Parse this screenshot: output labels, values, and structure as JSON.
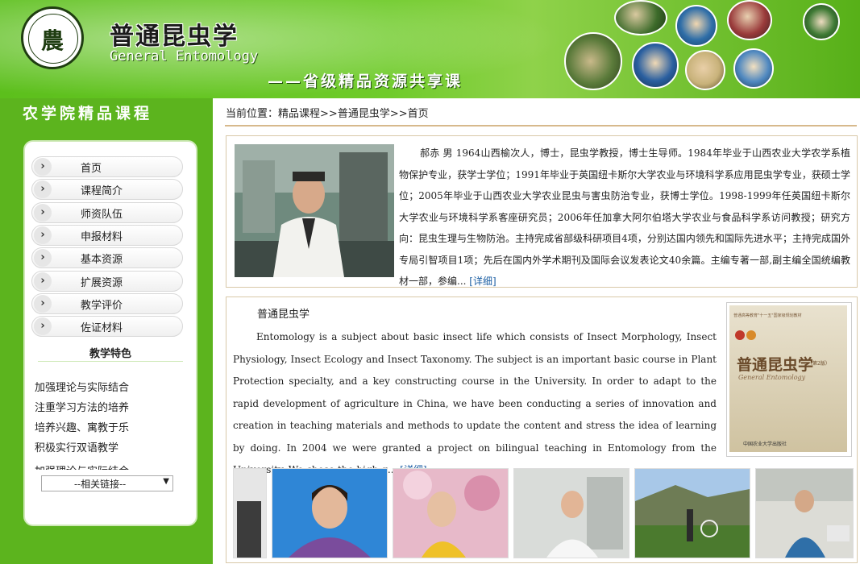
{
  "header": {
    "title_cn": "普通昆虫学",
    "title_en": "General Entomology",
    "subtitle": "——省级精品资源共享课",
    "logo_glyph": "農"
  },
  "sidebar": {
    "title": "农学院精品课程",
    "nav": [
      {
        "label": "首页",
        "icon": "chevron-right-icon"
      },
      {
        "label": "课程简介",
        "icon": "chevron-right-icon"
      },
      {
        "label": "师资队伍",
        "icon": "chevron-right-icon"
      },
      {
        "label": "申报材料",
        "icon": "chevron-right-icon"
      },
      {
        "label": "基本资源",
        "icon": "chevron-right-icon"
      },
      {
        "label": "扩展资源",
        "icon": "chevron-right-icon"
      },
      {
        "label": "教学评价",
        "icon": "chevron-right-icon"
      },
      {
        "label": "佐证材料",
        "icon": "chevron-right-icon"
      }
    ],
    "features_title": "教学特色",
    "features": [
      "加强理论与实际结合",
      "注重学习方法的培养",
      "培养兴趣、寓教于乐",
      "积极实行双语教学",
      "加强理论与实际结合"
    ],
    "links_select": "--相关链接--"
  },
  "breadcrumb": {
    "prefix": "当前位置：",
    "items": [
      "精品课程",
      ">>",
      "普通昆虫学",
      ">>",
      "首页"
    ]
  },
  "teacher": {
    "bio": "郝赤  男  1964山西榆次人，博士，昆虫学教授，博士生导师。1984年毕业于山西农业大学农学系植物保护专业，获学士学位；1991年毕业于英国纽卡斯尔大学农业与环境科学系应用昆虫学专业，获硕士学位；2005年毕业于山西农业大学农业昆虫与害虫防治专业，获博士学位。1998-1999年任英国纽卡斯尔大学农业与环境科学系客座研究员；2006年任加拿大阿尔伯塔大学农业与食品科学系访问教授；研究方向：昆虫生理与生物防治。主持完成省部级科研项目4项，分别达国内领先和国际先进水平；主持完成国外专局引智项目1项；先后在国内外学术期刊及国际会议发表论文40余篇。主编专著一部,副主编全国统编教材一部，参编...",
    "more": "[详细]"
  },
  "course": {
    "heading": "普通昆虫学",
    "intro": "Entomology is a subject about basic insect life which consists of Insect Morphology, Insect Physiology, Insect Ecology and Insect Taxonomy. The subject is an important basic course in Plant Protection specialty, and a key constructing course in the University. In order to adapt to the rapid development of agriculture in China, we have been conducting a series of innovation and creation in teaching materials and methods to update the content and stress the idea of learning by doing. In 2004 we were granted a project on bilingual teaching in Entomology from the University. We chose the high q...",
    "more": "[详细]",
    "book_top": "普通高等教育\"十一五\"国家级规划教材",
    "book_title": "普通昆虫学",
    "book_edition": "（第2版）",
    "book_en": "General Entomology",
    "book_publisher": "中国农业大学出版社"
  },
  "colors": {
    "banner_green": "#5cbf1c",
    "sidebar_green": "#5cb41e",
    "link_blue": "#1b5ea3",
    "border_tan": "#d7b98c"
  }
}
